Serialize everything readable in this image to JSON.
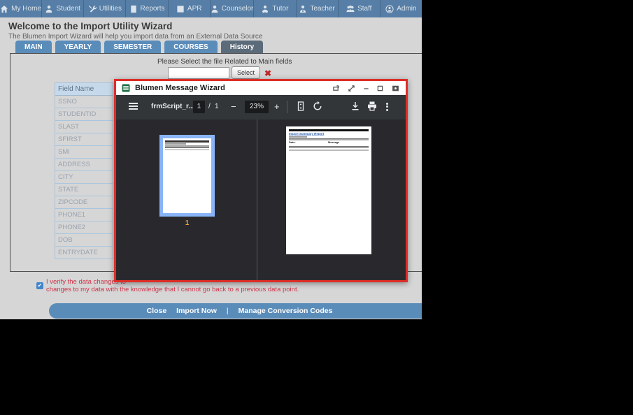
{
  "nav": {
    "items": [
      {
        "label": "My Home",
        "icon": "home-icon"
      },
      {
        "label": "Student",
        "icon": "student-icon"
      },
      {
        "label": "Utilities",
        "icon": "utilities-icon"
      },
      {
        "label": "Reports",
        "icon": "reports-icon"
      },
      {
        "label": "APR",
        "icon": "apr-icon"
      },
      {
        "label": "Counselor",
        "icon": "counselor-icon"
      },
      {
        "label": "Tutor",
        "icon": "tutor-icon"
      },
      {
        "label": "Teacher",
        "icon": "teacher-icon"
      },
      {
        "label": "Staff",
        "icon": "staff-icon"
      },
      {
        "label": "Admin",
        "icon": "admin-icon"
      }
    ]
  },
  "header": {
    "title": "Welcome to the Import Utility Wizard",
    "subtitle": "The Blumen Import Wizard will help you import data from an External Data Source"
  },
  "tabs": [
    {
      "label": "MAIN"
    },
    {
      "label": "YEARLY"
    },
    {
      "label": "SEMESTER"
    },
    {
      "label": "COURSES"
    },
    {
      "label": "History",
      "active": true
    }
  ],
  "file_select": {
    "prompt": "Please Select the file Related to Main fields",
    "input_value": "",
    "button_label": "Select",
    "clear_icon": "red-x-icon"
  },
  "field_table": {
    "header": "Field Name",
    "rows": [
      "SSNO",
      "STUDENTID",
      "SLAST",
      "SFIRST",
      "SMI",
      "ADDRESS",
      "CITY",
      "STATE",
      "ZIPCODE",
      "PHONE1",
      "PHONE2",
      "DOB",
      "ENTRYDATE"
    ]
  },
  "modal": {
    "title": "Blumen Message Wizard",
    "window_control_icons": [
      "popout-icon",
      "resize-icon",
      "minimize-icon",
      "maximize-icon",
      "capture-icon"
    ],
    "pdf_toolbar": {
      "menu_icon": "hamburger-menu-icon",
      "filename": "frmScript_r...",
      "page_current": "1",
      "page_separator": "/",
      "page_total": "1",
      "zoom_out": "−",
      "zoom_level": "23%",
      "zoom_in": "+",
      "fit_icon": "fit-to-page-icon",
      "rotate_icon": "rotate-icon",
      "download_icon": "download-icon",
      "print_icon": "print-icon",
      "more_icon": "kebab-menu-icon"
    },
    "thumbnail_page_number": "1",
    "document": {
      "title": "Import Summary Report",
      "date_label": "Date:",
      "message_label": "Message"
    }
  },
  "verify": {
    "line1": "I verify the data changes to",
    "line2": "changes to my data with the knowledge that I cannot go back to a previous data point."
  },
  "footer_actions": {
    "close": "Close",
    "import_now": "Import Now",
    "divider": "|",
    "manage": "Manage Conversion Codes"
  },
  "colors": {
    "nav_blue": "#567ea6",
    "tab_blue": "#5a8cba",
    "tab_active": "#5c6b7a",
    "modal_border_red": "#dd2e27",
    "toolbar_dark": "#323639",
    "pdf_background": "#29292d",
    "thumbnail_selection_blue": "#8ab4f8",
    "warning_text_red": "#cf3347",
    "footer_bar_blue": "#5a8cba"
  }
}
